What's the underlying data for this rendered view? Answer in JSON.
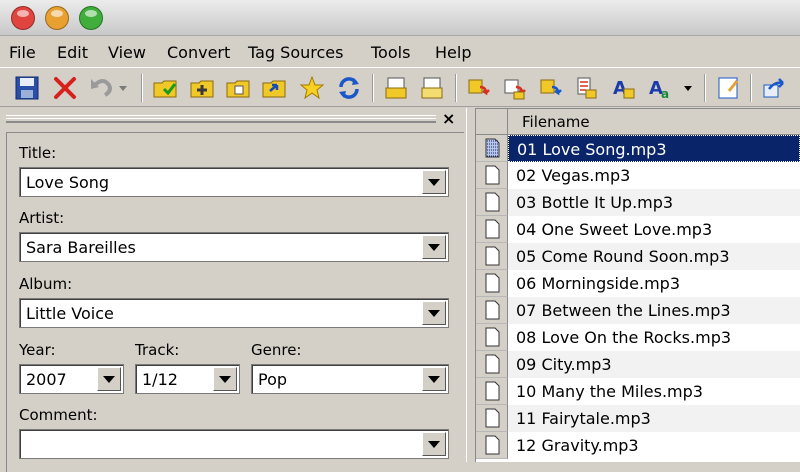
{
  "menu": [
    "File",
    "Edit",
    "View",
    "Convert",
    "Tag Sources",
    "Tools",
    "Help"
  ],
  "toolbar": {
    "icons": [
      "save-icon",
      "revert-icon",
      "undo-icon",
      "undo-dropdown-icon",
      "open-folder-icon",
      "add-folder-icon",
      "import-icon",
      "export-icon",
      "favorite-star-icon",
      "refresh-icon",
      "copy-tag-icon",
      "paste-tag-icon",
      "tag-to-filename-icon",
      "filename-to-tag-icon",
      "filename-to-filename-icon",
      "tag-to-tag-icon",
      "case-conversion-icon",
      "case-conversion-alt-icon",
      "case-dropdown-icon",
      "edit-icon",
      "exit-icon"
    ]
  },
  "panel": {
    "close_glyph": "×"
  },
  "form": {
    "title_label": "Title:",
    "title_value": "Love Song",
    "artist_label": "Artist:",
    "artist_value": "Sara Bareilles",
    "album_label": "Album:",
    "album_value": "Little Voice",
    "year_label": "Year:",
    "year_value": "2007",
    "track_label": "Track:",
    "track_value": "1/12",
    "genre_label": "Genre:",
    "genre_value": "Pop",
    "comment_label": "Comment:",
    "comment_value": ""
  },
  "file_list": {
    "header": "Filename",
    "files": [
      "01 Love Song.mp3",
      "02 Vegas.mp3",
      "03 Bottle It Up.mp3",
      "04 One Sweet Love.mp3",
      "05 Come Round Soon.mp3",
      "06 Morningside.mp3",
      "07 Between the Lines.mp3",
      "08 Love On the Rocks.mp3",
      "09 City.mp3",
      "10 Many the Miles.mp3",
      "11 Fairytale.mp3",
      "12 Gravity.mp3"
    ],
    "selected_index": 0
  },
  "colors": {
    "close": "#e0443e",
    "minimize": "#e8a030",
    "maximize": "#3fae3c",
    "selection": "#0a246a"
  }
}
